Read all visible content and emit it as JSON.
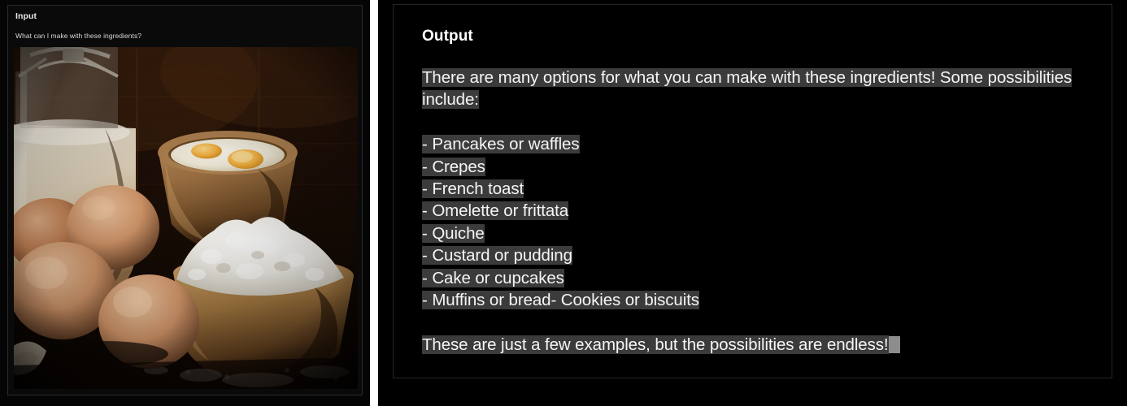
{
  "layout": {
    "background": "#ffffff",
    "panel_background": "#000000",
    "border_color": "#262626",
    "highlight_color": "#3b3b3b",
    "text_color": "#f2f2f2",
    "tail_block_color": "#8d8d8d"
  },
  "input": {
    "title": "Input",
    "prompt": "What can I make with these ingredients?",
    "image_alt": "Photograph of baking ingredients: a glass jug of milk, a wooden bowl with cracked eggs, brown eggs, and a wooden bowl of white flour on a dark wooden table"
  },
  "output": {
    "title": "Output",
    "intro": "There are many options for what you can make with these ingredients! Some possibilities include:",
    "items": [
      "- Pancakes or waffles",
      "- Crepes",
      "- French toast",
      "- Omelette or frittata",
      "- Quiche",
      "- Custard or pudding",
      "- Cake or cupcakes",
      "- Muffins or bread- Cookies or biscuits"
    ],
    "closing": "These are just a few examples, but the possibilities are endless!"
  }
}
